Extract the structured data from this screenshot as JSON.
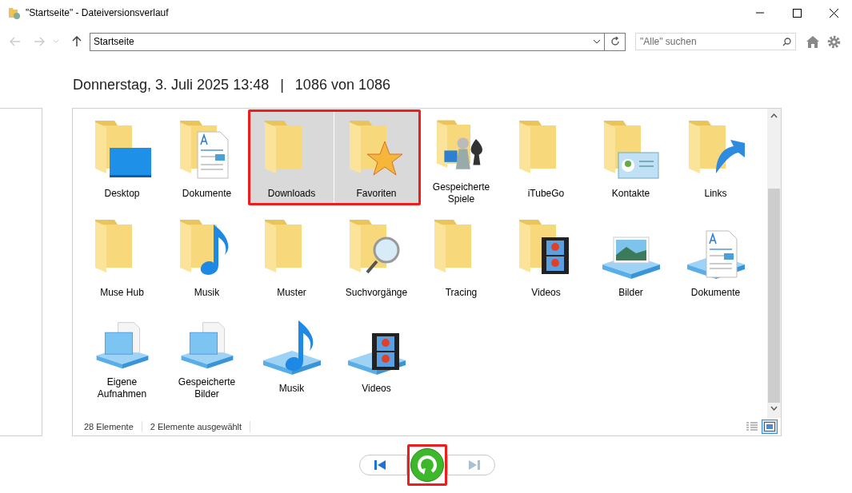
{
  "window": {
    "title": "\"Startseite\" - Dateiversionsverlauf"
  },
  "address": {
    "value": "Startseite"
  },
  "search": {
    "placeholder": "\"Alle\" suchen"
  },
  "heading": {
    "date": "Donnerstag, 3. Juli 2025 13:48",
    "separator": "|",
    "version": "1086 von 1086"
  },
  "folders": [
    {
      "label": "Desktop",
      "kind": "desktop",
      "selected": false
    },
    {
      "label": "Dokumente",
      "kind": "document",
      "selected": false
    },
    {
      "label": "Downloads",
      "kind": "plain",
      "selected": true
    },
    {
      "label": "Favoriten",
      "kind": "star",
      "selected": true
    },
    {
      "label": "Gespeicherte Spiele",
      "kind": "games",
      "selected": false
    },
    {
      "label": "iTubeGo",
      "kind": "plain",
      "selected": false
    },
    {
      "label": "Kontakte",
      "kind": "contact",
      "selected": false
    },
    {
      "label": "Links",
      "kind": "link",
      "selected": false
    },
    {
      "label": "Muse Hub",
      "kind": "plain",
      "selected": false
    },
    {
      "label": "Musik",
      "kind": "music",
      "selected": false
    },
    {
      "label": "Muster",
      "kind": "plain",
      "selected": false
    },
    {
      "label": "Suchvorgänge",
      "kind": "search",
      "selected": false
    },
    {
      "label": "Tracing",
      "kind": "plain",
      "selected": false
    },
    {
      "label": "Videos",
      "kind": "film",
      "selected": false
    }
  ],
  "libraries": [
    {
      "label": "Bilder",
      "kind": "picture",
      "selected": false
    },
    {
      "label": "Dokumente",
      "kind": "document",
      "selected": false
    },
    {
      "label": "Eigene Aufnahmen",
      "kind": "screen",
      "selected": false
    },
    {
      "label": "Gespeicherte Bilder",
      "kind": "screen",
      "selected": false
    },
    {
      "label": "Musik",
      "kind": "music",
      "selected": false
    },
    {
      "label": "Videos",
      "kind": "film",
      "selected": false
    }
  ],
  "highlight_selection": true,
  "status_bar": {
    "count": "28 Elemente",
    "selection": "2 Elemente ausgewählt",
    "large_icons_view": true
  },
  "playback": {
    "previous_disabled": false,
    "next_disabled": true,
    "restore_highlighted": true
  }
}
